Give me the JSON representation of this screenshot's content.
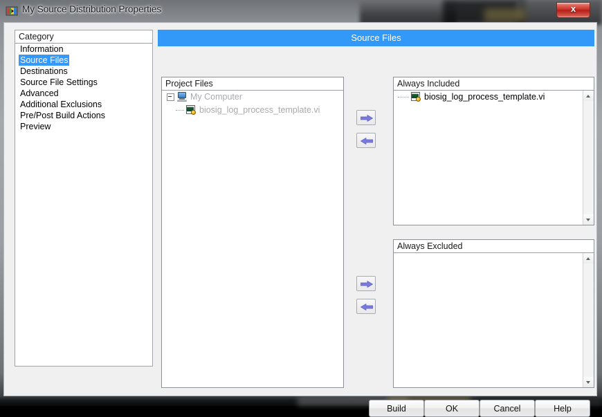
{
  "window": {
    "title": "My Source Distribution Properties",
    "app_icon": "labview-icon",
    "close_label": "x"
  },
  "banner": {
    "title": "Source Files"
  },
  "category": {
    "header": "Category",
    "selected": "Source Files",
    "items": [
      {
        "label": "Information",
        "selected": false
      },
      {
        "label": "Source Files",
        "selected": true
      },
      {
        "label": "Destinations",
        "selected": false
      },
      {
        "label": "Source File Settings",
        "selected": false
      },
      {
        "label": "Advanced",
        "selected": false
      },
      {
        "label": "Additional Exclusions",
        "selected": false
      },
      {
        "label": "Pre/Post Build Actions",
        "selected": false
      },
      {
        "label": "Preview",
        "selected": false
      }
    ]
  },
  "project_files": {
    "header": "Project Files",
    "root": {
      "label": "My Computer",
      "icon": "computer-icon",
      "expanded": true
    },
    "children": [
      {
        "label": "biosig_log_process_template.vi",
        "icon": "vi-file-icon"
      }
    ]
  },
  "always_included": {
    "header": "Always Included",
    "items": [
      {
        "label": "biosig_log_process_template.vi",
        "icon": "vi-file-icon"
      }
    ]
  },
  "always_excluded": {
    "header": "Always Excluded",
    "items": []
  },
  "transfer_buttons": {
    "top_add": "arrow-right-icon",
    "top_remove": "arrow-left-icon",
    "bottom_add": "arrow-right-icon",
    "bottom_remove": "arrow-left-icon"
  },
  "footer": {
    "build": "Build",
    "ok": "OK",
    "cancel": "Cancel",
    "help": "Help"
  },
  "colors": {
    "banner_blue": "#3399f8",
    "selection_blue": "#3399ff",
    "dialog_bg": "#f0f0f0",
    "arrow_purple": "#7b7bdd",
    "close_red": "#c32a20",
    "dim_text": "#a9aaac"
  }
}
